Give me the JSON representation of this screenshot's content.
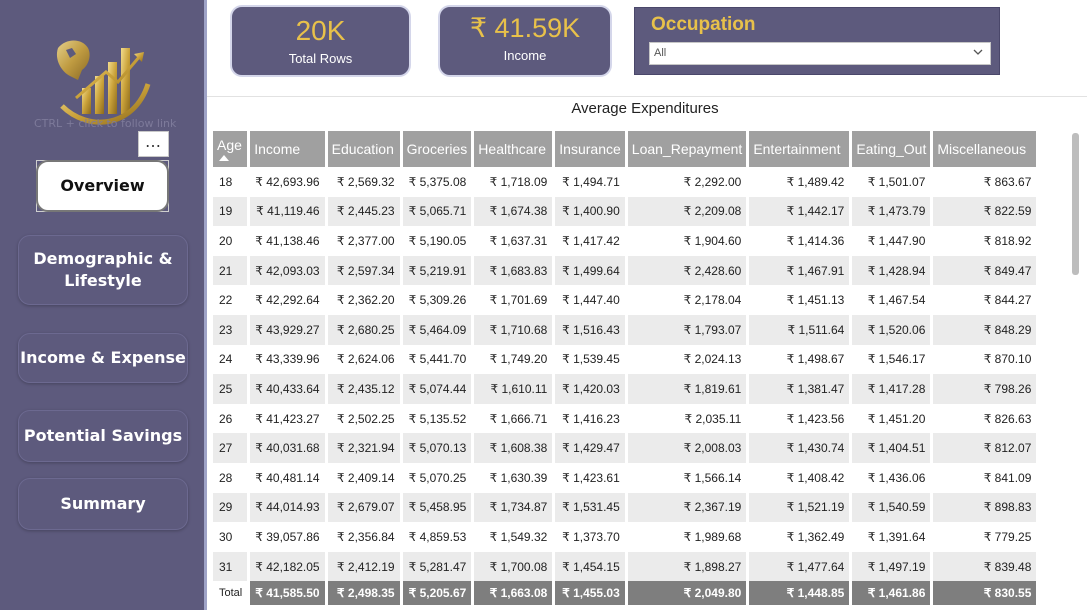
{
  "sidebar": {
    "tooltip": "CTRL + click to follow link",
    "more_label": "…",
    "nav": {
      "overview": "Overview",
      "demographic": "Demographic & Lifestyle",
      "income_expense": "Income & Expense",
      "potential_savings": "Potential Savings",
      "summary": "Summary"
    }
  },
  "kpis": {
    "total_rows": {
      "value": "20K",
      "label": "Total Rows"
    },
    "income": {
      "value": "₹ 41.59K",
      "label": "Income"
    }
  },
  "slicer": {
    "title": "Occupation",
    "selected": "All",
    "icon": "chevron-down-icon"
  },
  "table": {
    "title": "Average Expenditures",
    "sort_icon": "sort-ascending-icon",
    "columns": [
      "Age",
      "Income",
      "Education",
      "Groceries",
      "Healthcare",
      "Insurance",
      "Loan_Repayment",
      "Entertainment",
      "Eating_Out",
      "Miscellaneous"
    ],
    "rows": [
      [
        "18",
        "₹ 42,693.96",
        "₹ 2,569.32",
        "₹ 5,375.08",
        "₹ 1,718.09",
        "₹ 1,494.71",
        "₹ 2,292.00",
        "₹ 1,489.42",
        "₹ 1,501.07",
        "₹ 863.67"
      ],
      [
        "19",
        "₹ 41,119.46",
        "₹ 2,445.23",
        "₹ 5,065.71",
        "₹ 1,674.38",
        "₹ 1,400.90",
        "₹ 2,209.08",
        "₹ 1,442.17",
        "₹ 1,473.79",
        "₹ 822.59"
      ],
      [
        "20",
        "₹ 41,138.46",
        "₹ 2,377.00",
        "₹ 5,190.05",
        "₹ 1,637.31",
        "₹ 1,417.42",
        "₹ 1,904.60",
        "₹ 1,414.36",
        "₹ 1,447.90",
        "₹ 818.92"
      ],
      [
        "21",
        "₹ 42,093.03",
        "₹ 2,597.34",
        "₹ 5,219.91",
        "₹ 1,683.83",
        "₹ 1,499.64",
        "₹ 2,428.60",
        "₹ 1,467.91",
        "₹ 1,428.94",
        "₹ 849.47"
      ],
      [
        "22",
        "₹ 42,292.64",
        "₹ 2,362.20",
        "₹ 5,309.26",
        "₹ 1,701.69",
        "₹ 1,447.40",
        "₹ 2,178.04",
        "₹ 1,451.13",
        "₹ 1,467.54",
        "₹ 844.27"
      ],
      [
        "23",
        "₹ 43,929.27",
        "₹ 2,680.25",
        "₹ 5,464.09",
        "₹ 1,710.68",
        "₹ 1,516.43",
        "₹ 1,793.07",
        "₹ 1,511.64",
        "₹ 1,520.06",
        "₹ 848.29"
      ],
      [
        "24",
        "₹ 43,339.96",
        "₹ 2,624.06",
        "₹ 5,441.70",
        "₹ 1,749.20",
        "₹ 1,539.45",
        "₹ 2,024.13",
        "₹ 1,498.67",
        "₹ 1,546.17",
        "₹ 870.10"
      ],
      [
        "25",
        "₹ 40,433.64",
        "₹ 2,435.12",
        "₹ 5,074.44",
        "₹ 1,610.11",
        "₹ 1,420.03",
        "₹ 1,819.61",
        "₹ 1,381.47",
        "₹ 1,417.28",
        "₹ 798.26"
      ],
      [
        "26",
        "₹ 41,423.27",
        "₹ 2,502.25",
        "₹ 5,135.52",
        "₹ 1,666.71",
        "₹ 1,416.23",
        "₹ 2,035.11",
        "₹ 1,423.56",
        "₹ 1,451.20",
        "₹ 826.63"
      ],
      [
        "27",
        "₹ 40,031.68",
        "₹ 2,321.94",
        "₹ 5,070.13",
        "₹ 1,608.38",
        "₹ 1,429.47",
        "₹ 2,008.03",
        "₹ 1,430.74",
        "₹ 1,404.51",
        "₹ 812.07"
      ],
      [
        "28",
        "₹ 40,481.14",
        "₹ 2,409.14",
        "₹ 5,070.25",
        "₹ 1,630.39",
        "₹ 1,423.61",
        "₹ 1,566.14",
        "₹ 1,408.42",
        "₹ 1,436.06",
        "₹ 841.09"
      ],
      [
        "29",
        "₹ 44,014.93",
        "₹ 2,679.07",
        "₹ 5,458.95",
        "₹ 1,734.87",
        "₹ 1,531.45",
        "₹ 2,367.19",
        "₹ 1,521.19",
        "₹ 1,540.59",
        "₹ 898.83"
      ],
      [
        "30",
        "₹ 39,057.86",
        "₹ 2,356.84",
        "₹ 4,859.53",
        "₹ 1,549.32",
        "₹ 1,373.70",
        "₹ 1,989.68",
        "₹ 1,362.49",
        "₹ 1,391.64",
        "₹ 779.25"
      ],
      [
        "31",
        "₹ 42,182.05",
        "₹ 2,412.19",
        "₹ 5,281.47",
        "₹ 1,700.08",
        "₹ 1,454.15",
        "₹ 1,898.27",
        "₹ 1,477.64",
        "₹ 1,497.19",
        "₹ 839.48"
      ]
    ],
    "total": [
      "Total",
      "₹ 41,585.50",
      "₹ 2,498.35",
      "₹ 5,205.67",
      "₹ 1,663.08",
      "₹ 1,455.03",
      "₹ 2,049.80",
      "₹ 1,448.85",
      "₹ 1,461.86",
      "₹ 830.55"
    ]
  },
  "colors": {
    "sidebar_bg": "#5d5a7d",
    "accent_gold": "#e8c14a",
    "header_grey": "#a0a0a0",
    "total_grey": "#7e7e7e"
  }
}
